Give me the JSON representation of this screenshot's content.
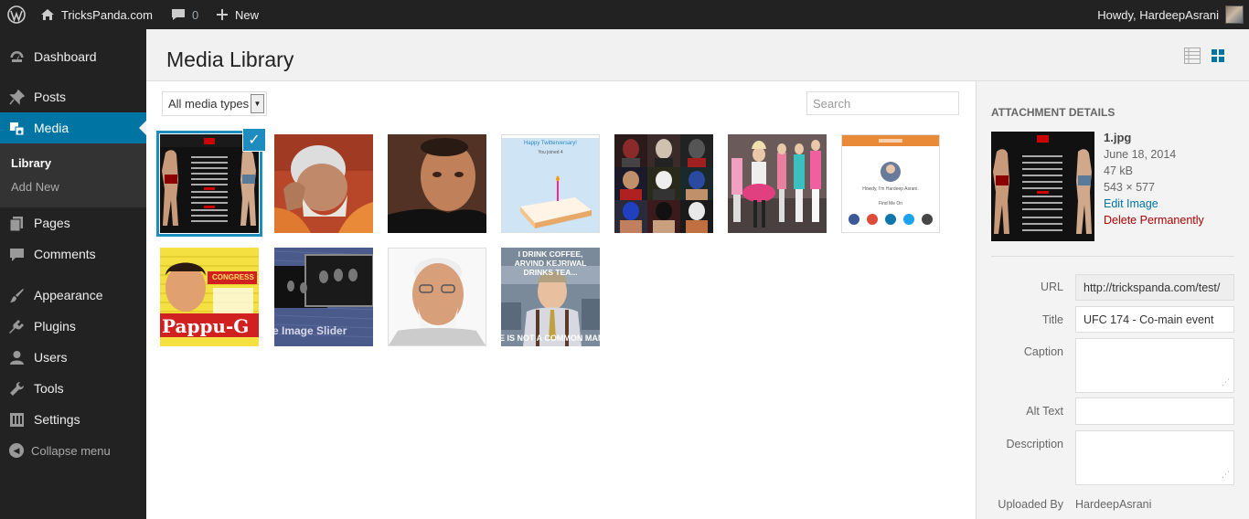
{
  "admin_bar": {
    "site_name": "TricksPanda.com",
    "comments_count": "0",
    "new_label": "New",
    "howdy": "Howdy, HardeepAsrani"
  },
  "sidebar": {
    "items": [
      {
        "label": "Dashboard",
        "icon": "dashboard-icon"
      },
      {
        "label": "Posts",
        "icon": "pin-icon"
      },
      {
        "label": "Media",
        "icon": "media-icon"
      },
      {
        "label": "Pages",
        "icon": "pages-icon"
      },
      {
        "label": "Comments",
        "icon": "comment-icon"
      },
      {
        "label": "Appearance",
        "icon": "brush-icon"
      },
      {
        "label": "Plugins",
        "icon": "plug-icon"
      },
      {
        "label": "Users",
        "icon": "users-icon"
      },
      {
        "label": "Tools",
        "icon": "wrench-icon"
      },
      {
        "label": "Settings",
        "icon": "settings-icon"
      }
    ],
    "submenu": [
      "Library",
      "Add New"
    ],
    "collapse_label": "Collapse menu"
  },
  "page": {
    "title": "Media Library"
  },
  "toolbar": {
    "filter_value": "All media types",
    "search_placeholder": "Search"
  },
  "media_tiles": [
    {
      "name": "ufc-fight-card",
      "selected": true
    },
    {
      "name": "modi-orange"
    },
    {
      "name": "fighter-closeup"
    },
    {
      "name": "twitterversary-cake"
    },
    {
      "name": "masked-wrestlers-collage"
    },
    {
      "name": "fashion-group"
    },
    {
      "name": "howdy-profile-card"
    },
    {
      "name": "pappu-g-poster"
    },
    {
      "name": "image-slider-banner"
    },
    {
      "name": "modi-portrait"
    },
    {
      "name": "coffee-meme"
    }
  ],
  "tile_text": {
    "congress": "CONGRESS",
    "pappu": "Pappu-G",
    "slider": "e Image Slider",
    "meme_top": "I DRINK COFFEE, ARVIND KEJRIWAL DRINKS TEA...",
    "meme_bottom": "E IS NOT A COMMON MAN",
    "twitter_title": "Happy Twitterversary!",
    "twitter_sub": "You joined 4",
    "howdy_card": "Howdy, I'm Hardeep Asrani.",
    "find_me": "Find Me On"
  },
  "attachment": {
    "heading": "ATTACHMENT DETAILS",
    "filename": "1.jpg",
    "date": "June 18, 2014",
    "size": "47 kB",
    "dimensions": "543 × 577",
    "edit_link": "Edit Image",
    "delete_link": "Delete Permanently",
    "fields": {
      "url_label": "URL",
      "url_value": "http://trickspanda.com/test/",
      "title_label": "Title",
      "title_value": "UFC 174 - Co-main event",
      "caption_label": "Caption",
      "caption_value": "",
      "alt_label": "Alt Text",
      "alt_value": "",
      "description_label": "Description",
      "description_value": "",
      "uploaded_by_label": "Uploaded By",
      "uploaded_by_value": "HardeepAsrani"
    }
  },
  "colors": {
    "admin_dark": "#222222",
    "accent": "#0074a2",
    "select_blue": "#1e8cbe",
    "delete_red": "#aa0000"
  }
}
